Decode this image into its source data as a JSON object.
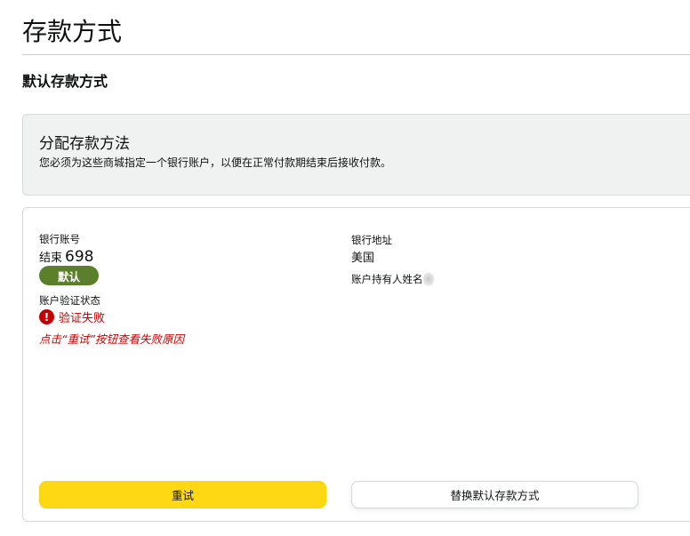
{
  "page": {
    "title": "存款方式"
  },
  "default_section": {
    "title": "默认存款方式"
  },
  "assign": {
    "title": "分配存款方法",
    "description": "您必须为这些商城指定一个银行账户，以便在正常付款期结束后接收付款。"
  },
  "bank": {
    "account_label": "银行账号",
    "account_end_prefix": "结束",
    "account_end_digits": "698",
    "default_badge": "默认",
    "verification_label": "账户验证状态",
    "verification_status": "验证失败",
    "verification_hint": "点击“重试”按钮查看失败原因",
    "address_label": "银行地址",
    "address_value": "美国",
    "holder_label": "账户持有人姓名"
  },
  "buttons": {
    "retry": "重试",
    "replace": "替换默认存款方式"
  },
  "colors": {
    "primary_button": "#ffd814",
    "badge": "#5b7f2a",
    "error": "#c40000"
  },
  "icons": {
    "error": "alert-circle-icon"
  }
}
